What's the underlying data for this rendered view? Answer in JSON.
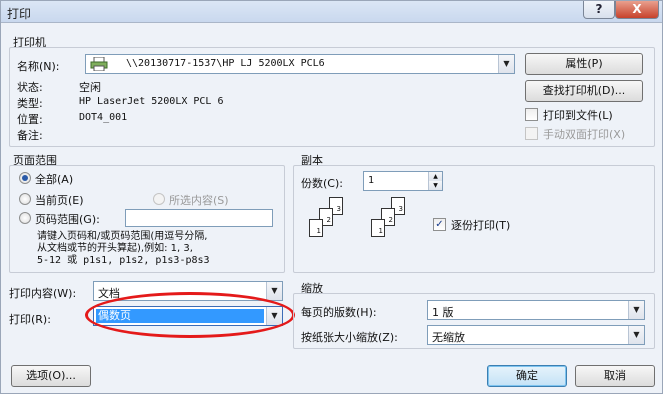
{
  "window": {
    "title": "打印",
    "help_label": "?",
    "close_label": "X"
  },
  "printer": {
    "group_label": "打印机",
    "name_label": "名称(N):",
    "name_value": "\\\\20130717-1537\\HP LJ 5200LX PCL6",
    "status_label": "状态:",
    "status_value": "空闲",
    "type_label": "类型:",
    "type_value": "HP LaserJet 5200LX PCL 6",
    "where_label": "位置:",
    "where_value": "DOT4_001",
    "comment_label": "备注:",
    "properties_button": "属性(P)",
    "find_printer_button": "查找打印机(D)...",
    "print_to_file_label": "打印到文件(L)",
    "manual_duplex_label": "手动双面打印(X)",
    "print_to_file_checked": false,
    "manual_duplex_checked": false
  },
  "page_range": {
    "group_label": "页面范围",
    "all_label": "全部(A)",
    "current_label": "当前页(E)",
    "selection_label": "所选内容(S)",
    "pages_label": "页码范围(G):",
    "pages_value": "",
    "selected": "all",
    "hint_line1": "请键入页码和/或页码范围(用逗号分隔,",
    "hint_line2": "从文档或节的开头算起),例如: 1, 3,",
    "hint_line3": "5-12 或 p1s1, p1s2, p1s3-p8s3"
  },
  "copies": {
    "group_label": "副本",
    "count_label": "份数(C):",
    "count_value": "1",
    "collate_label": "逐份打印(T)",
    "collate_checked": true,
    "page_numbers": [
      "3",
      "2",
      "1",
      "3",
      "2",
      "1"
    ]
  },
  "print_what": {
    "label": "打印内容(W):",
    "value": "文档"
  },
  "print": {
    "label": "打印(R):",
    "value": "偶数页"
  },
  "zoom": {
    "group_label": "缩放",
    "pages_per_sheet_label": "每页的版数(H):",
    "pages_per_sheet_value": "1 版",
    "scale_label": "按纸张大小缩放(Z):",
    "scale_value": "无缩放"
  },
  "footer": {
    "options_button": "选项(O)...",
    "ok_button": "确定",
    "cancel_button": "取消"
  },
  "colors": {
    "highlight_oval": "#e41a1a",
    "selection": "#3399ff"
  }
}
